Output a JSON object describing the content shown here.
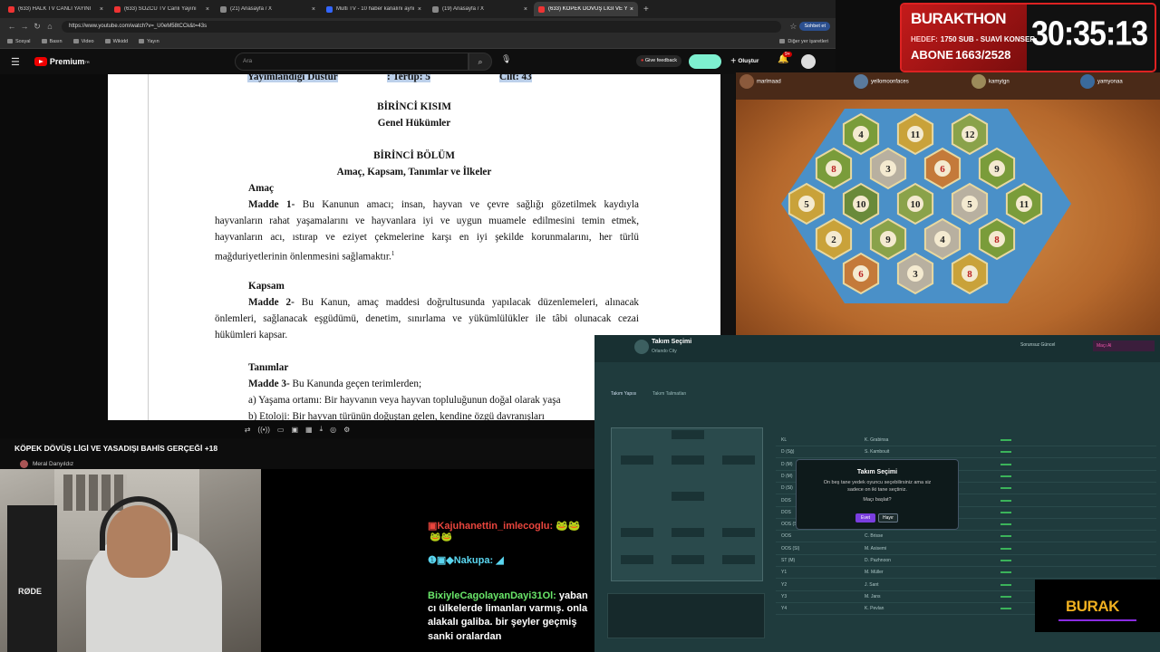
{
  "browser": {
    "tabs": [
      {
        "title": "(633) HALK TV CANLI YAYINI",
        "color": "#e33",
        "active": false
      },
      {
        "title": "(633) SÖZCÜ TV Canlı Yayını",
        "color": "#e33",
        "active": false
      },
      {
        "title": "(21) Anasayfa / X",
        "color": "#888",
        "active": false
      },
      {
        "title": "Multi TV - 10 haber kanalını aynı",
        "color": "#36f",
        "active": false
      },
      {
        "title": "(19) Anasayfa / X",
        "color": "#888",
        "active": false
      },
      {
        "title": "(633) KÖPEK DÖVÜŞ LİGİ VE Y",
        "color": "#e33",
        "active": true
      }
    ],
    "url": "https://www.youtube.com/watch?v=_U0eM58tCCk&t=43s",
    "bookmarks": [
      "Sosyal",
      "Basın",
      "Video",
      "Wikidd",
      "Yayın"
    ],
    "bookmarks_other": "Diğer yer işaretleri",
    "profile_label": "Sohbet et"
  },
  "youtube": {
    "brand": "Premium",
    "brand_sup": "TR",
    "search_placeholder": "Ara",
    "feedback_label": "Give feedback",
    "create_label": "Oluştur",
    "notif_count": "9+",
    "video_title": "KÖPEK DÖVÜŞ LİGİ VE YASADIŞI BAHİS GERÇEĞİ +18",
    "channel_name": "Meral Danyıldız"
  },
  "document": {
    "header_left": "Yayımlandığı Düstur",
    "header_mid": ": Tertip: 5",
    "header_right": "Cilt: 43",
    "part": "BİRİNCİ KISIM",
    "part_sub": "Genel Hükümler",
    "chapter": "BİRİNCİ BÖLÜM",
    "chapter_sub": "Amaç, Kapsam, Tanımlar ve İlkeler",
    "s1_title": "Amaç",
    "s1_lead": "Madde 1-",
    "s1_l1": "Bu Kanunun amacı; insan, hayvan ve çevre sağlığı gözetilmek kaydıyla",
    "s1_l2": "hayvanların rahat yaşamalarını ve hayvanlara iyi ve uygun muamele edilmesini temin etmek,",
    "s1_l3": "hayvanların acı, ıstırap ve eziyet çekmelerine karşı en iyi şekilde korunmalarını, her türlü",
    "s1_l4": "mağduriyetlerinin önlenmesini sağlamaktır.",
    "s1_fn": "1",
    "s2_title": "Kapsam",
    "s2_lead": "Madde 2-",
    "s2_l1": "Bu Kanun, amaç maddesi doğrultusunda yapılacak düzenlemeleri, alınacak",
    "s2_l2": "önlemleri, sağlanacak eşgüdümü, denetim, sınırlama ve yükümlülükler ile tâbi olunacak cezai",
    "s2_l3": "hükümleri kapsar.",
    "s3_title": "Tanımlar",
    "s3_lead": "Madde 3-",
    "s3_l1": "Bu Kanunda geçen terimlerden;",
    "s3_l2": "a) Yaşama ortamı: Bir hayvanın veya hayvan topluluğunun doğal olarak yaşa",
    "s3_l3": "b) Etoloji: Bir hayvan türünün doğuştan gelen, kendine özgü davranışları"
  },
  "chat": {
    "m1_user": "Kajuhanettin_imlecoglu:",
    "m2_user": "Nakupa:",
    "m3_user": "BixiyleCagolayanDayi31Ol:",
    "m3_text": "yaban",
    "m3_l2": "cı ülkelerde limanları varmış. onla",
    "m3_l3": "alakalı galiba. bir şeyler geçmiş",
    "m3_l4": "sanki oralardan"
  },
  "overlay": {
    "name": "BURAKTHON",
    "hedef_label": "HEDEF:",
    "hedef_value": "1750 SUB - SUAVİ KONSER",
    "abone_label": "ABONE",
    "abone_value": "1663/2528",
    "timer": "30:35:13",
    "badge": "BURAK",
    "accent": "#d22"
  },
  "catan": {
    "players": [
      "marlmaad",
      "yellomoonfaces",
      "kamytgn",
      "yamyonaa"
    ],
    "numbers": [
      "4",
      "11",
      "12",
      "8",
      "3",
      "6",
      "9",
      "5",
      "10",
      "10",
      "5",
      "11",
      "2",
      "9",
      "4",
      "8",
      "6",
      "3",
      "8"
    ]
  },
  "fm": {
    "title": "Takım Seçimi",
    "subtitle": "Orlando City",
    "right_label": "Sorunsuz Güncel",
    "done_label": "Maçı Al",
    "tabs": [
      "Takım Yapısı",
      "Takım Talimatları"
    ],
    "rows": [
      {
        "pos": "KL",
        "name": "K. Grabinsa"
      },
      {
        "pos": "D (Sğ)",
        "name": "S. Kambouit"
      },
      {
        "pos": "D (M)",
        "name": "R. Jansen"
      },
      {
        "pos": "D (M)",
        "name": "A. Araujo"
      },
      {
        "pos": "D (Sl)",
        "name": "H. Freeman"
      },
      {
        "pos": "DOS",
        "name": "J. Jaime"
      },
      {
        "pos": "DOS",
        "name": "W. Boydan"
      },
      {
        "pos": "OOS (Sğ)",
        "name": "R. Lamb"
      },
      {
        "pos": "OOS",
        "name": "C. Brisse"
      },
      {
        "pos": "OOS (Sl)",
        "name": "M. Asisemi"
      },
      {
        "pos": "ST (M)",
        "name": "D. Pazhnoon"
      },
      {
        "pos": "Y1",
        "name": "M. Müller"
      },
      {
        "pos": "Y2",
        "name": "J. Sant"
      },
      {
        "pos": "Y3",
        "name": "M. Jans"
      },
      {
        "pos": "Y4",
        "name": "K. Pevlan"
      }
    ],
    "dialog_title": "Takım Seçimi",
    "dialog_body_1": "On beş tane yedek oyuncu seçebilirsiniz ama siz",
    "dialog_body_2": "sadece on iki tane seçtiniz.",
    "dialog_question": "Maçı başlat?",
    "dialog_yes": "Evet",
    "dialog_no": "Hayır"
  }
}
